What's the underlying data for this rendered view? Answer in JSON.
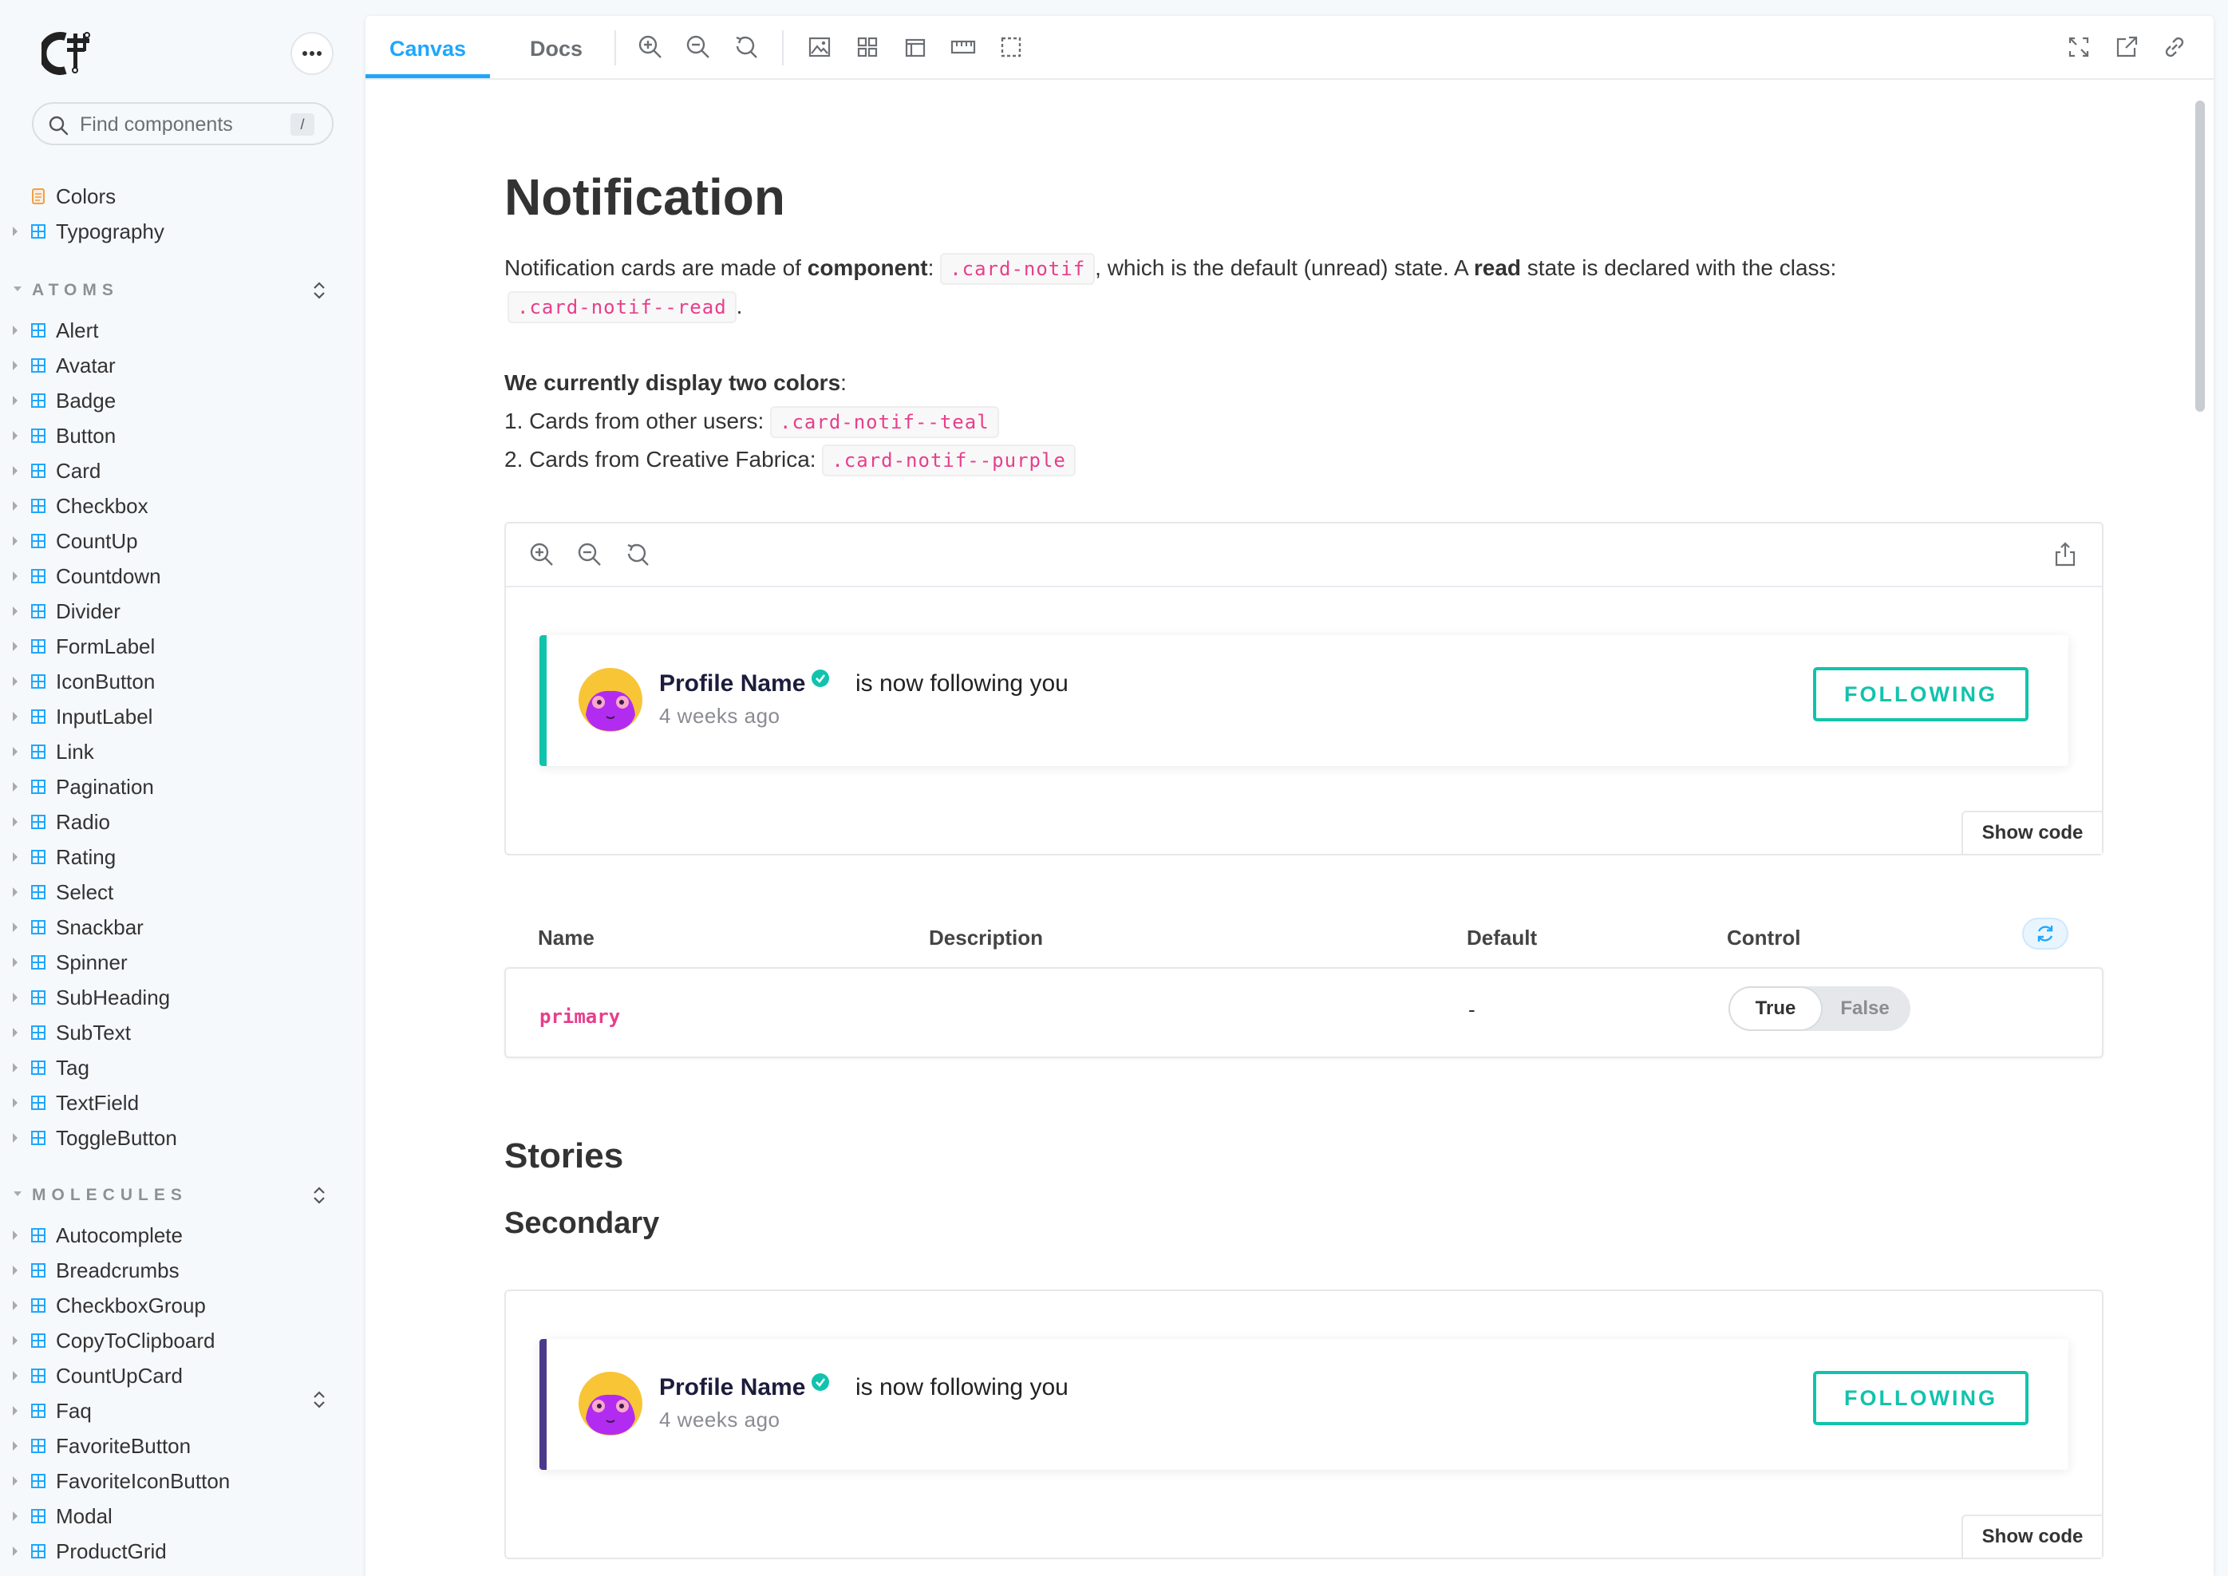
{
  "sidebar": {
    "search": {
      "placeholder": "Find components",
      "shortcut": "/"
    },
    "top_items": [
      {
        "label": "Colors",
        "icon": "document-icon"
      },
      {
        "label": "Typography",
        "icon": "component-icon"
      }
    ],
    "sections": [
      {
        "title": "ATOMS",
        "items": [
          "Alert",
          "Avatar",
          "Badge",
          "Button",
          "Card",
          "Checkbox",
          "CountUp",
          "Countdown",
          "Divider",
          "FormLabel",
          "IconButton",
          "InputLabel",
          "Link",
          "Pagination",
          "Radio",
          "Rating",
          "Select",
          "Snackbar",
          "Spinner",
          "SubHeading",
          "SubText",
          "Tag",
          "TextField",
          "ToggleButton"
        ]
      },
      {
        "title": "MOLECULES",
        "items": [
          "Autocomplete",
          "Breadcrumbs",
          "CheckboxGroup",
          "CopyToClipboard",
          "CountUpCard",
          "Faq",
          "FavoriteButton",
          "FavoriteIconButton",
          "Modal",
          "ProductGrid"
        ]
      }
    ]
  },
  "toolbar": {
    "tabs": [
      "Canvas",
      "Docs"
    ],
    "active_tab": "Canvas",
    "accent_color": "#1ea7fd"
  },
  "doc": {
    "title": "Notification",
    "intro": {
      "t1": "Notification cards are made of ",
      "b1": "component",
      "t2": ": ",
      "code1": ".card-notif",
      "t3": ", which is the default (unread) state. A ",
      "b2": "read",
      "t4": " state is declared with the class:",
      "code2": ".card-notif--read",
      "t5": "."
    },
    "colors_heading": "We currently display two colors",
    "colors_heading_suffix": ":",
    "line1_text": "1. Cards from other users: ",
    "line1_code": ".card-notif--teal",
    "line2_text": "2. Cards from Creative Fabrica: ",
    "line2_code": ".card-notif--purple",
    "primary_card": {
      "profile_name": "Profile Name",
      "action": "is now following you",
      "time": "4 weeks ago",
      "button": "FOLLOWING",
      "bar_color": "#11c3ac"
    },
    "show_code": "Show code",
    "args_table": {
      "headers": {
        "name": "Name",
        "description": "Description",
        "default": "Default",
        "control": "Control"
      },
      "rows": [
        {
          "name": "primary",
          "description": "",
          "default": "-",
          "control_options": [
            "True",
            "False"
          ],
          "selected": "True"
        }
      ]
    },
    "stories_heading": "Stories",
    "secondary_heading": "Secondary",
    "secondary_card": {
      "profile_name": "Profile Name",
      "action": "is now following you",
      "time": "4 weeks ago",
      "button": "FOLLOWING",
      "bar_color": "#4b3a8c"
    }
  }
}
